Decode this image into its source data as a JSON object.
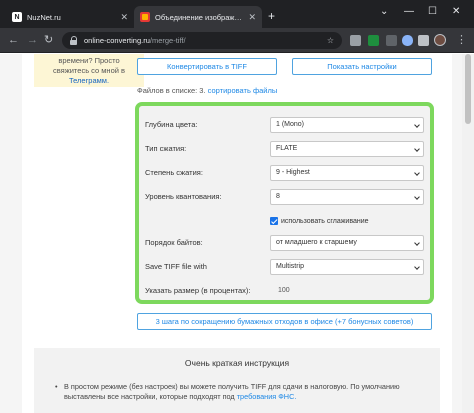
{
  "browser": {
    "tabs": [
      {
        "title": "NuzNet.ru",
        "active": false
      },
      {
        "title": "Объединение изображений в T",
        "active": true
      }
    ],
    "new_tab_label": "+",
    "address": {
      "domain": "online-converting.ru",
      "path": "/merge-tiff/"
    },
    "window_controls": {
      "chevron": "⌄",
      "minimize": "—",
      "maximize": "☐",
      "close": "✕"
    }
  },
  "notice": {
    "line1": "времени? Просто",
    "line2": "свяжитесь со мной в",
    "link": "Телеграмм."
  },
  "buttons": {
    "convert": "Конвертировать в TIFF",
    "show_settings": "Показать настройки",
    "waste_tips": "3 шага по сокращению бумажных отходов в офисе (+7 бонусных советов)"
  },
  "files_line": {
    "prefix": "Файлов в списке: 3.",
    "sort_link": "сортировать файлы"
  },
  "settings": {
    "color_depth": {
      "label": "Глубина цвета:",
      "value": "1 (Mono)"
    },
    "compression_type": {
      "label": "Тип сжатия:",
      "value": "FLATE"
    },
    "compression_level": {
      "label": "Степень сжатия:",
      "value": "9 - Highest"
    },
    "quantization_level": {
      "label": "Уровень квантования:",
      "value": "8"
    },
    "smoothing": {
      "label": "использовать сглаживание",
      "checked": true
    },
    "byte_order": {
      "label": "Порядок байтов:",
      "value": "от младшего к старшему"
    },
    "save_with": {
      "label": "Save TIFF file with",
      "value": "Multistrip"
    },
    "size_percent": {
      "label": "Указать размер (в процентах):",
      "value": "100"
    }
  },
  "instructions": {
    "title": "Очень краткая инструкция",
    "text": "В простом режиме (без настроек) вы можете получить TIFF для сдачи в налоговую. По умолчанию выставлены все настройки, которые подходят под",
    "link": "требования ФНС."
  },
  "colors": {
    "highlight_border": "#7dd85d",
    "link": "#1e88e5",
    "notice_bg": "#fdf6d5",
    "chrome_dark": "#202124"
  }
}
